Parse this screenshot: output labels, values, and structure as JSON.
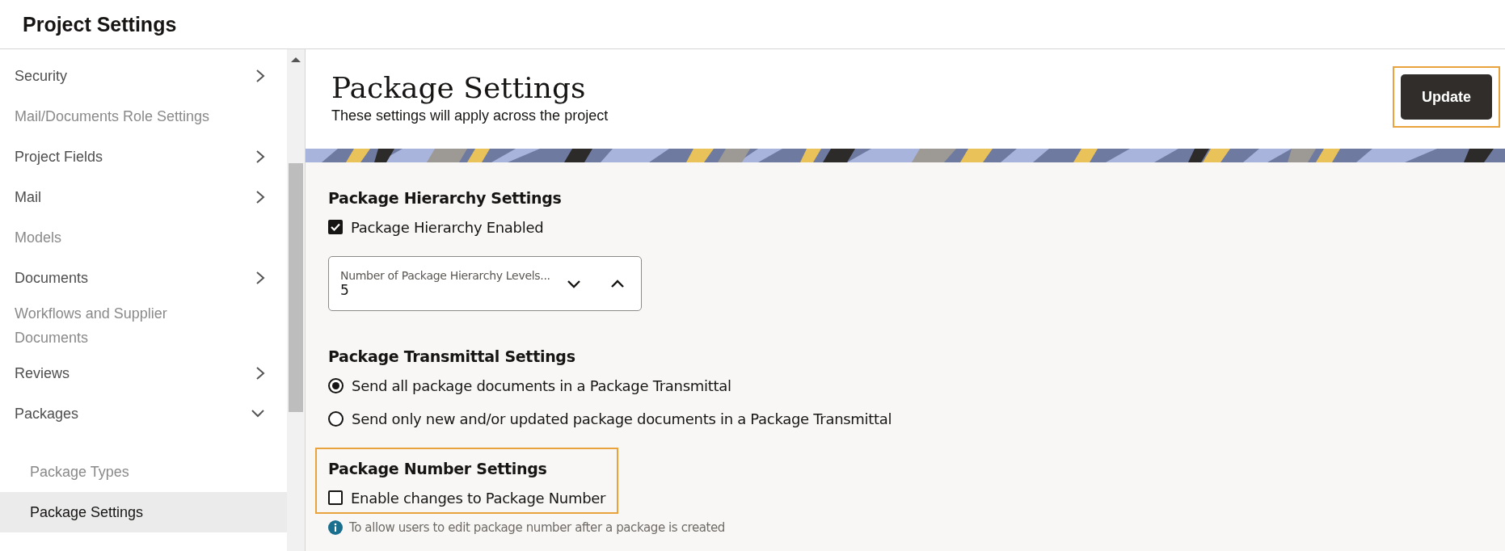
{
  "header": {
    "title": "Project Settings"
  },
  "sidebar": {
    "items": [
      {
        "label": "Security",
        "kind": "group",
        "expanded": false,
        "disabled": false,
        "selected": false
      },
      {
        "label": "Mail/Documents Role Settings",
        "kind": "link",
        "disabled": true,
        "selected": false
      },
      {
        "label": "Project Fields",
        "kind": "group",
        "expanded": false,
        "disabled": false,
        "selected": false
      },
      {
        "label": "Mail",
        "kind": "group",
        "expanded": false,
        "disabled": false,
        "selected": false
      },
      {
        "label": "Models",
        "kind": "link",
        "disabled": true,
        "selected": false
      },
      {
        "label": "Documents",
        "kind": "group",
        "expanded": false,
        "disabled": false,
        "selected": false
      },
      {
        "label": "Workflows and Supplier Documents",
        "kind": "link",
        "disabled": true,
        "selected": false
      },
      {
        "label": "Reviews",
        "kind": "group",
        "expanded": false,
        "disabled": false,
        "selected": false
      },
      {
        "label": "Packages",
        "kind": "group",
        "expanded": true,
        "disabled": false,
        "selected": false,
        "children": [
          {
            "label": "Package Types",
            "kind": "link",
            "disabled": true,
            "selected": false
          },
          {
            "label": "Package Settings",
            "kind": "link",
            "disabled": false,
            "selected": true
          }
        ]
      }
    ]
  },
  "page": {
    "title": "Package Settings",
    "subtitle": "These settings will apply across the project",
    "update_button": "Update"
  },
  "sections": [
    {
      "heading": "Package Hierarchy Settings",
      "controls": [
        {
          "kind": "checkbox",
          "label": "Package Hierarchy Enabled",
          "checked": true
        },
        {
          "kind": "number",
          "label": "Number of Package Hierarchy Levels...",
          "value": "5"
        }
      ]
    },
    {
      "heading": "Package Transmittal Settings",
      "controls": [
        {
          "kind": "radio",
          "label": "Send all package documents in a Package Transmittal",
          "selected": true
        },
        {
          "kind": "radio",
          "label": "Send only new and/or updated package documents in a Package Transmittal",
          "selected": false
        }
      ]
    },
    {
      "heading": "Package Number Settings",
      "highlighted": true,
      "controls": [
        {
          "kind": "checkbox",
          "label": "Enable changes to Package Number",
          "checked": false
        }
      ],
      "hint": "To allow users to edit package number after a package is created"
    }
  ]
}
